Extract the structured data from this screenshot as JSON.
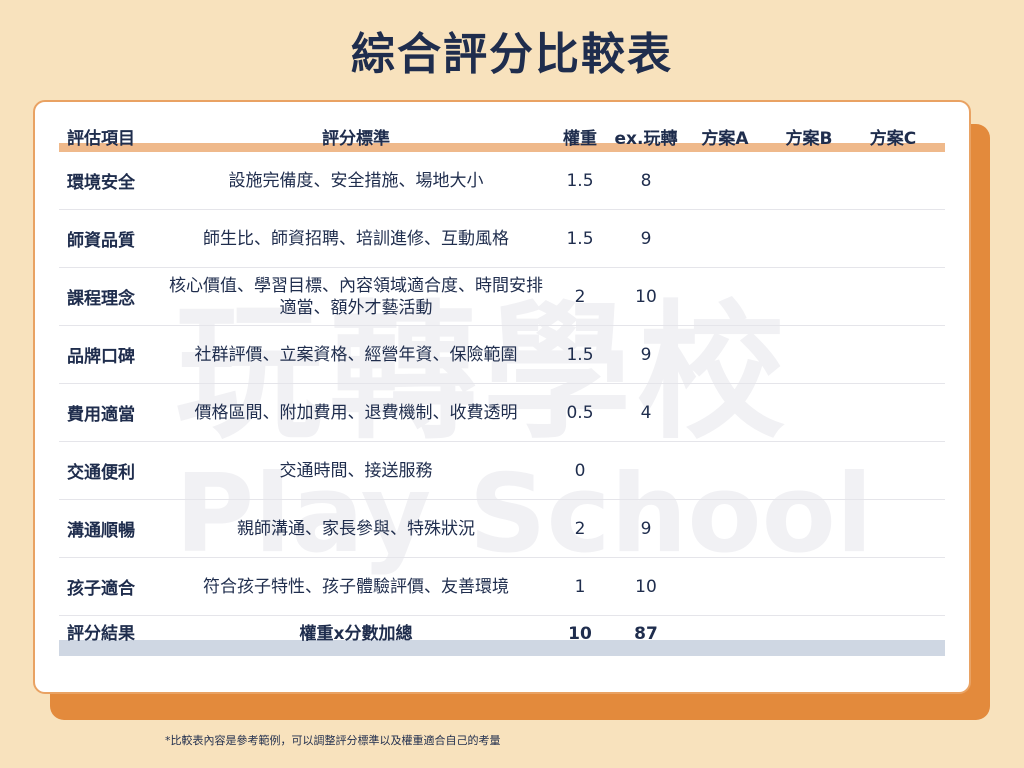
{
  "title": "綜合評分比較表",
  "watermark": {
    "cn": "玩轉學校",
    "en": "Play School"
  },
  "table": {
    "headers": [
      "評估項目",
      "評分標準",
      "權重",
      "ex.玩轉",
      "方案A",
      "方案B",
      "方案C"
    ],
    "rows": [
      {
        "item": "環境安全",
        "criteria": "設施完備度、安全措施、場地大小",
        "weight": "1.5",
        "example": "8",
        "a": "",
        "b": "",
        "c": ""
      },
      {
        "item": "師資品質",
        "criteria": "師生比、師資招聘、培訓進修、互動風格",
        "weight": "1.5",
        "example": "9",
        "a": "",
        "b": "",
        "c": ""
      },
      {
        "item": "課程理念",
        "criteria": "核心價值、學習目標、內容領域適合度、時間安排適當、額外才藝活動",
        "weight": "2",
        "example": "10",
        "a": "",
        "b": "",
        "c": ""
      },
      {
        "item": "品牌口碑",
        "criteria": "社群評價、立案資格、經營年資、保險範圍",
        "weight": "1.5",
        "example": "9",
        "a": "",
        "b": "",
        "c": ""
      },
      {
        "item": "費用適當",
        "criteria": "價格區間、附加費用、退費機制、收費透明",
        "weight": "0.5",
        "example": "4",
        "a": "",
        "b": "",
        "c": ""
      },
      {
        "item": "交通便利",
        "criteria": "交通時間、接送服務",
        "weight": "0",
        "example": "",
        "a": "",
        "b": "",
        "c": ""
      },
      {
        "item": "溝通順暢",
        "criteria": "親師溝通、家長參與、特殊狀況",
        "weight": "2",
        "example": "9",
        "a": "",
        "b": "",
        "c": ""
      },
      {
        "item": "孩子適合",
        "criteria": "符合孩子特性、孩子體驗評價、友善環境",
        "weight": "1",
        "example": "10",
        "a": "",
        "b": "",
        "c": ""
      }
    ],
    "footer": {
      "item": "評分結果",
      "criteria": "權重x分數加總",
      "weight": "10",
      "example": "87",
      "a": "",
      "b": "",
      "c": ""
    }
  },
  "note": "*比較表內容是參考範例，可以調整評分標準以及權重適合自己的考量",
  "colors": {
    "background": "#f8e2bd",
    "title": "#1f2d4d",
    "accent": "#e38a3c",
    "header_band": "#efb98b",
    "footer_band": "#cfd7e3"
  }
}
